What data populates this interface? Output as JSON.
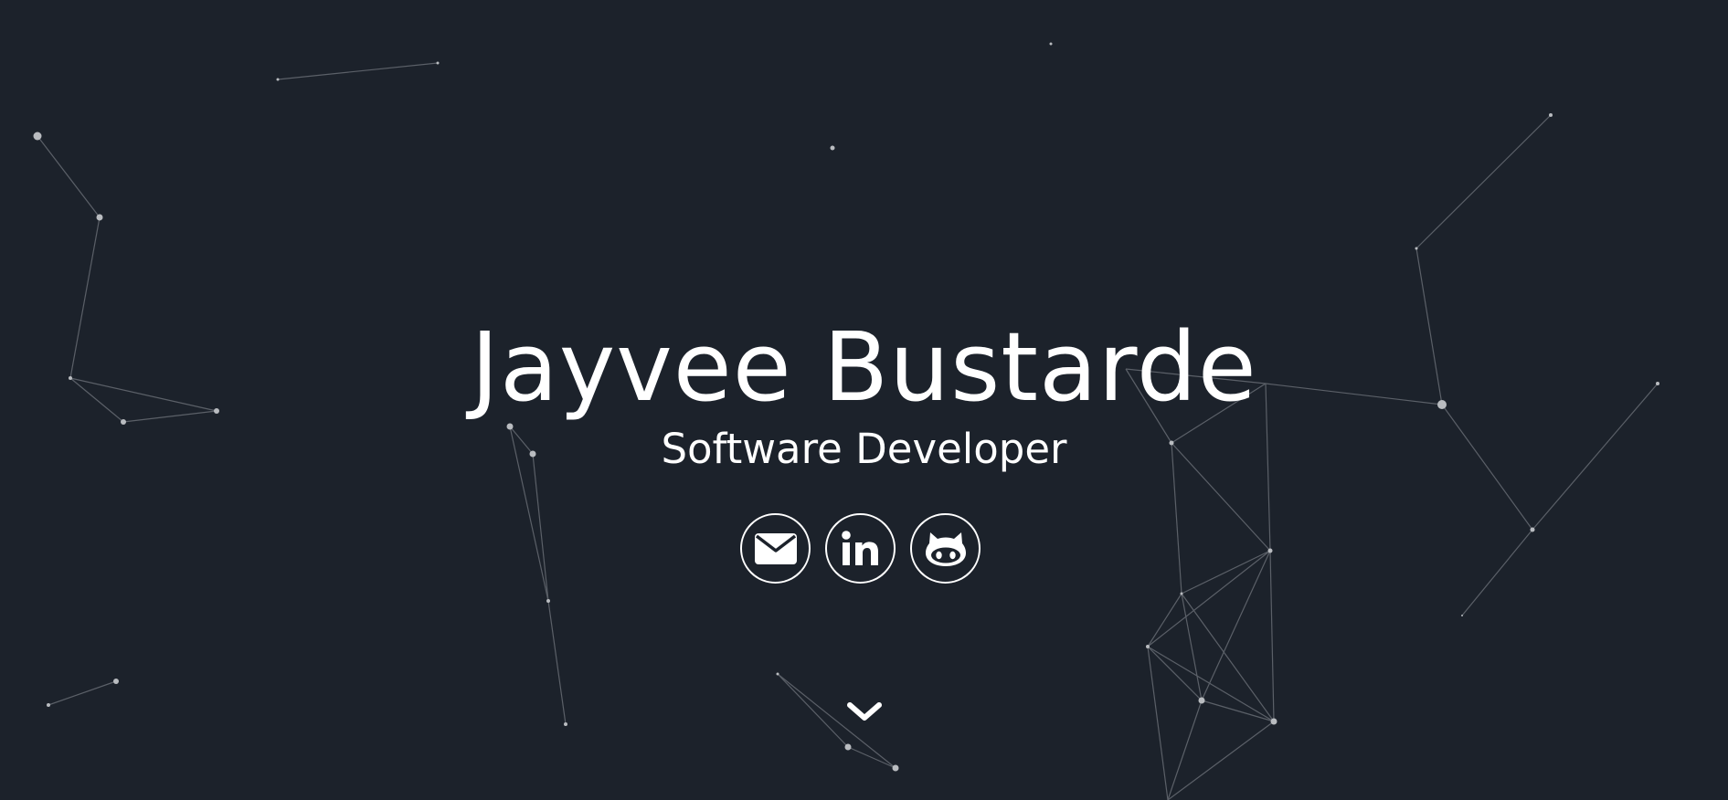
{
  "hero": {
    "name": "Jayvee Bustarde",
    "role": "Software Developer"
  },
  "social": [
    {
      "name": "email",
      "icon": "envelope-icon"
    },
    {
      "name": "linkedin",
      "icon": "linkedin-icon",
      "glyph": "in"
    },
    {
      "name": "github",
      "icon": "github-octocat-icon"
    }
  ],
  "scroll": {
    "icon": "chevron-down-icon"
  },
  "colors": {
    "background": "#1c222b",
    "foreground": "#ffffff",
    "particle_line": "#5b6068",
    "particle_dot": "#b9bcc0"
  }
}
